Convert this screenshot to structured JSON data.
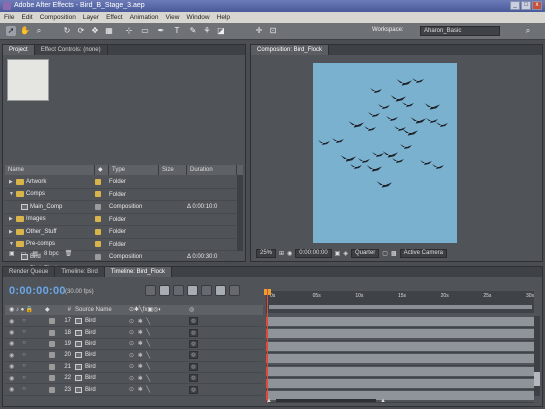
{
  "window": {
    "title": "Adobe After Effects - Bird_B_Stage_3.aep",
    "buttons": [
      "_",
      "□",
      "x"
    ]
  },
  "menu": [
    "File",
    "Edit",
    "Composition",
    "Layer",
    "Effect",
    "Animation",
    "View",
    "Window",
    "Help"
  ],
  "toolbar": {
    "tools": [
      "select-tool",
      "hand-tool",
      "zoom-tool",
      "rotate-tool",
      "orbit-tool",
      "pan-behind-tool",
      "mask-tool",
      "pen-tool",
      "type-tool",
      "brush-tool",
      "clone-tool",
      "eraser-tool",
      "puppet-tool"
    ],
    "workspace_label": "Workspace:",
    "workspace_value": "Aharon_Basic"
  },
  "project_panel": {
    "tabs": [
      "Project",
      "Effect Controls: (none)"
    ],
    "columns": [
      "Name",
      "Type",
      "Size",
      "Duration"
    ],
    "items": [
      {
        "name": "Artwork",
        "indent": 0,
        "kind": "folder",
        "expanded": false,
        "label_color": "#d9b44a",
        "type": "Folder",
        "size": "",
        "duration": ""
      },
      {
        "name": "Comps",
        "indent": 0,
        "kind": "folder",
        "expanded": true,
        "label_color": "#d9b44a",
        "type": "Folder",
        "size": "",
        "duration": ""
      },
      {
        "name": "Main_Comp",
        "indent": 1,
        "kind": "comp",
        "expanded": false,
        "label_color": "#9a9a9a",
        "type": "Composition",
        "size": "",
        "duration": "Δ 0:00:10:0"
      },
      {
        "name": "Images",
        "indent": 0,
        "kind": "folder",
        "expanded": false,
        "label_color": "#d9b44a",
        "type": "Folder",
        "size": "",
        "duration": ""
      },
      {
        "name": "Other_Stuff",
        "indent": 0,
        "kind": "folder",
        "expanded": false,
        "label_color": "#d9b44a",
        "type": "Folder",
        "size": "",
        "duration": ""
      },
      {
        "name": "Pre-comps",
        "indent": 0,
        "kind": "folder",
        "expanded": true,
        "label_color": "#d9b44a",
        "type": "Folder",
        "size": "",
        "duration": ""
      },
      {
        "name": "Bird",
        "indent": 1,
        "kind": "comp",
        "expanded": false,
        "label_color": "#9a9a9a",
        "type": "Composition",
        "size": "",
        "duration": "Δ 0:00:30:0"
      },
      {
        "name": "Bird_Flock",
        "indent": 1,
        "kind": "comp",
        "expanded": false,
        "label_color": "#9a9a9a",
        "type": "Composition",
        "size": "",
        "duration": "Δ 0:00:30:0"
      }
    ],
    "footer": {
      "bpc": "8 bpc"
    }
  },
  "comp_panel": {
    "tab": "Composition: Bird_Flock",
    "zoom": "25%",
    "timecode": "0:00:00:00",
    "resolution": "Quarter",
    "camera": "Active Camera",
    "viewer_color": "#7ab1cf"
  },
  "timeline": {
    "tabs": [
      "Render Queue",
      "Timeline: Bird",
      "Timeline: Bird_Flock"
    ],
    "active_tab": 2,
    "timecode": "0:00:00:00",
    "fps": "(30.00 fps)",
    "columns": [
      "#",
      "Source Name"
    ],
    "ruler_ticks": [
      "0s",
      "05s",
      "10s",
      "15s",
      "20s",
      "25s",
      "30s"
    ],
    "layers": [
      {
        "num": "17",
        "source": "Bird"
      },
      {
        "num": "18",
        "source": "Bird"
      },
      {
        "num": "19",
        "source": "Bird"
      },
      {
        "num": "20",
        "source": "Bird"
      },
      {
        "num": "21",
        "source": "Bird"
      },
      {
        "num": "22",
        "source": "Bird"
      },
      {
        "num": "23",
        "source": "Bird"
      }
    ]
  }
}
